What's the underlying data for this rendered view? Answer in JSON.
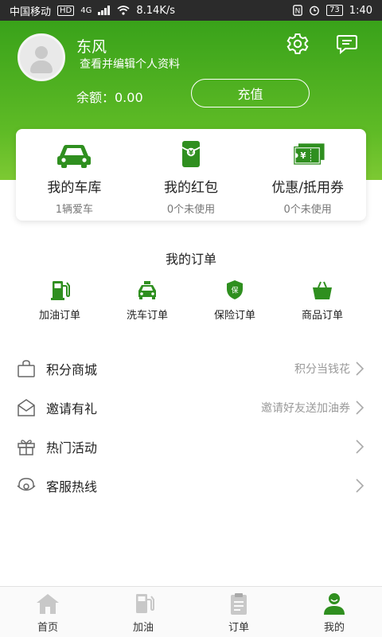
{
  "status_bar": {
    "carrier": "中国移动",
    "hd": "HD",
    "network": "4G",
    "speed": "8.14K/s",
    "battery": "73",
    "time": "1:40"
  },
  "profile": {
    "username": "东风",
    "edit_label": "查看并编辑个人资料",
    "balance_label": "余额：0.00",
    "recharge_label": "充值"
  },
  "card": {
    "items": [
      {
        "title": "我的车库",
        "sub": "1辆爱车",
        "icon": "car-icon"
      },
      {
        "title": "我的红包",
        "sub": "0个未使用",
        "icon": "red-packet-icon"
      },
      {
        "title": "优惠/抵用券",
        "sub": "0个未使用",
        "icon": "coupon-icon"
      }
    ]
  },
  "orders": {
    "title": "我的订单",
    "items": [
      {
        "label": "加油订单",
        "icon": "fuel-pump-icon"
      },
      {
        "label": "洗车订单",
        "icon": "taxi-icon"
      },
      {
        "label": "保险订单",
        "icon": "insurance-shield-icon"
      },
      {
        "label": "商品订单",
        "icon": "shopping-basket-icon"
      }
    ]
  },
  "menu": {
    "items": [
      {
        "label": "积分商城",
        "hint": "积分当钱花",
        "icon": "bag-icon"
      },
      {
        "label": "邀请有礼",
        "hint": "邀请好友送加油券",
        "icon": "envelope-icon"
      },
      {
        "label": "热门活动",
        "hint": "",
        "icon": "gift-icon"
      },
      {
        "label": "客服热线",
        "hint": "",
        "icon": "headset-icon"
      }
    ]
  },
  "tabbar": {
    "items": [
      {
        "label": "首页",
        "icon": "home-icon",
        "active": false
      },
      {
        "label": "加油",
        "icon": "fuel-pump-icon",
        "active": false
      },
      {
        "label": "订单",
        "icon": "clipboard-icon",
        "active": false
      },
      {
        "label": "我的",
        "icon": "user-icon",
        "active": true
      }
    ]
  },
  "colors": {
    "brand_green": "#39a21a",
    "inactive_gray": "#c8c8c8"
  }
}
